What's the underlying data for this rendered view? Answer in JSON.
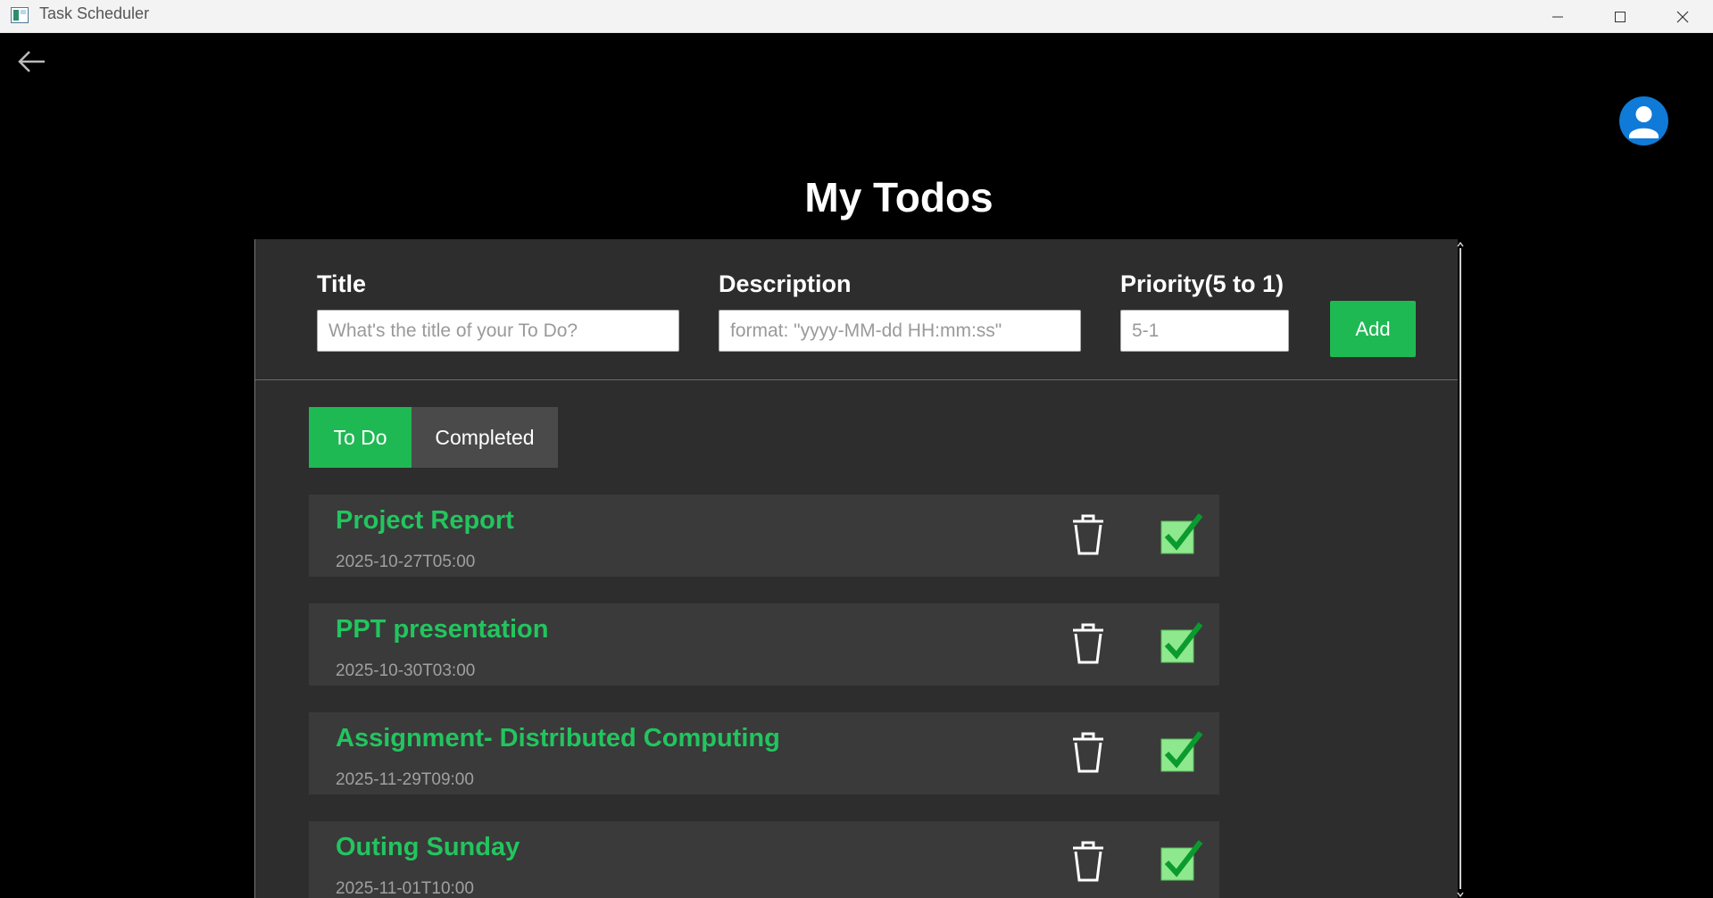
{
  "window": {
    "title": "Task Scheduler"
  },
  "page": {
    "title": "My Todos"
  },
  "form": {
    "title_label": "Title",
    "title_placeholder": "What's the title of your To Do?",
    "description_label": "Description",
    "description_placeholder": "format: \"yyyy-MM-dd HH:mm:ss\"",
    "priority_label": "Priority(5 to 1)",
    "priority_placeholder": "5-1",
    "add_label": "Add"
  },
  "tabs": [
    {
      "label": "To Do",
      "active": true
    },
    {
      "label": "Completed",
      "active": false
    }
  ],
  "todos": [
    {
      "title": "Project Report",
      "date": "2025-10-27T05:00"
    },
    {
      "title": "PPT presentation",
      "date": "2025-10-30T03:00"
    },
    {
      "title": "Assignment- Distributed Computing",
      "date": "2025-11-29T09:00"
    },
    {
      "title": "Outing Sunday",
      "date": "2025-11-01T10:00"
    }
  ],
  "colors": {
    "accent": "#1fb954",
    "todo_title": "#22c55e",
    "panel_bg": "#2d2d2d",
    "item_bg": "#3a3a3a",
    "avatar_bg": "#0f7ad8",
    "checkbox_fill": "#8ee88e"
  },
  "icons": {
    "back": "arrow-left-icon",
    "avatar": "user-icon",
    "delete": "trash-icon",
    "complete": "checkbox-checked-icon"
  }
}
